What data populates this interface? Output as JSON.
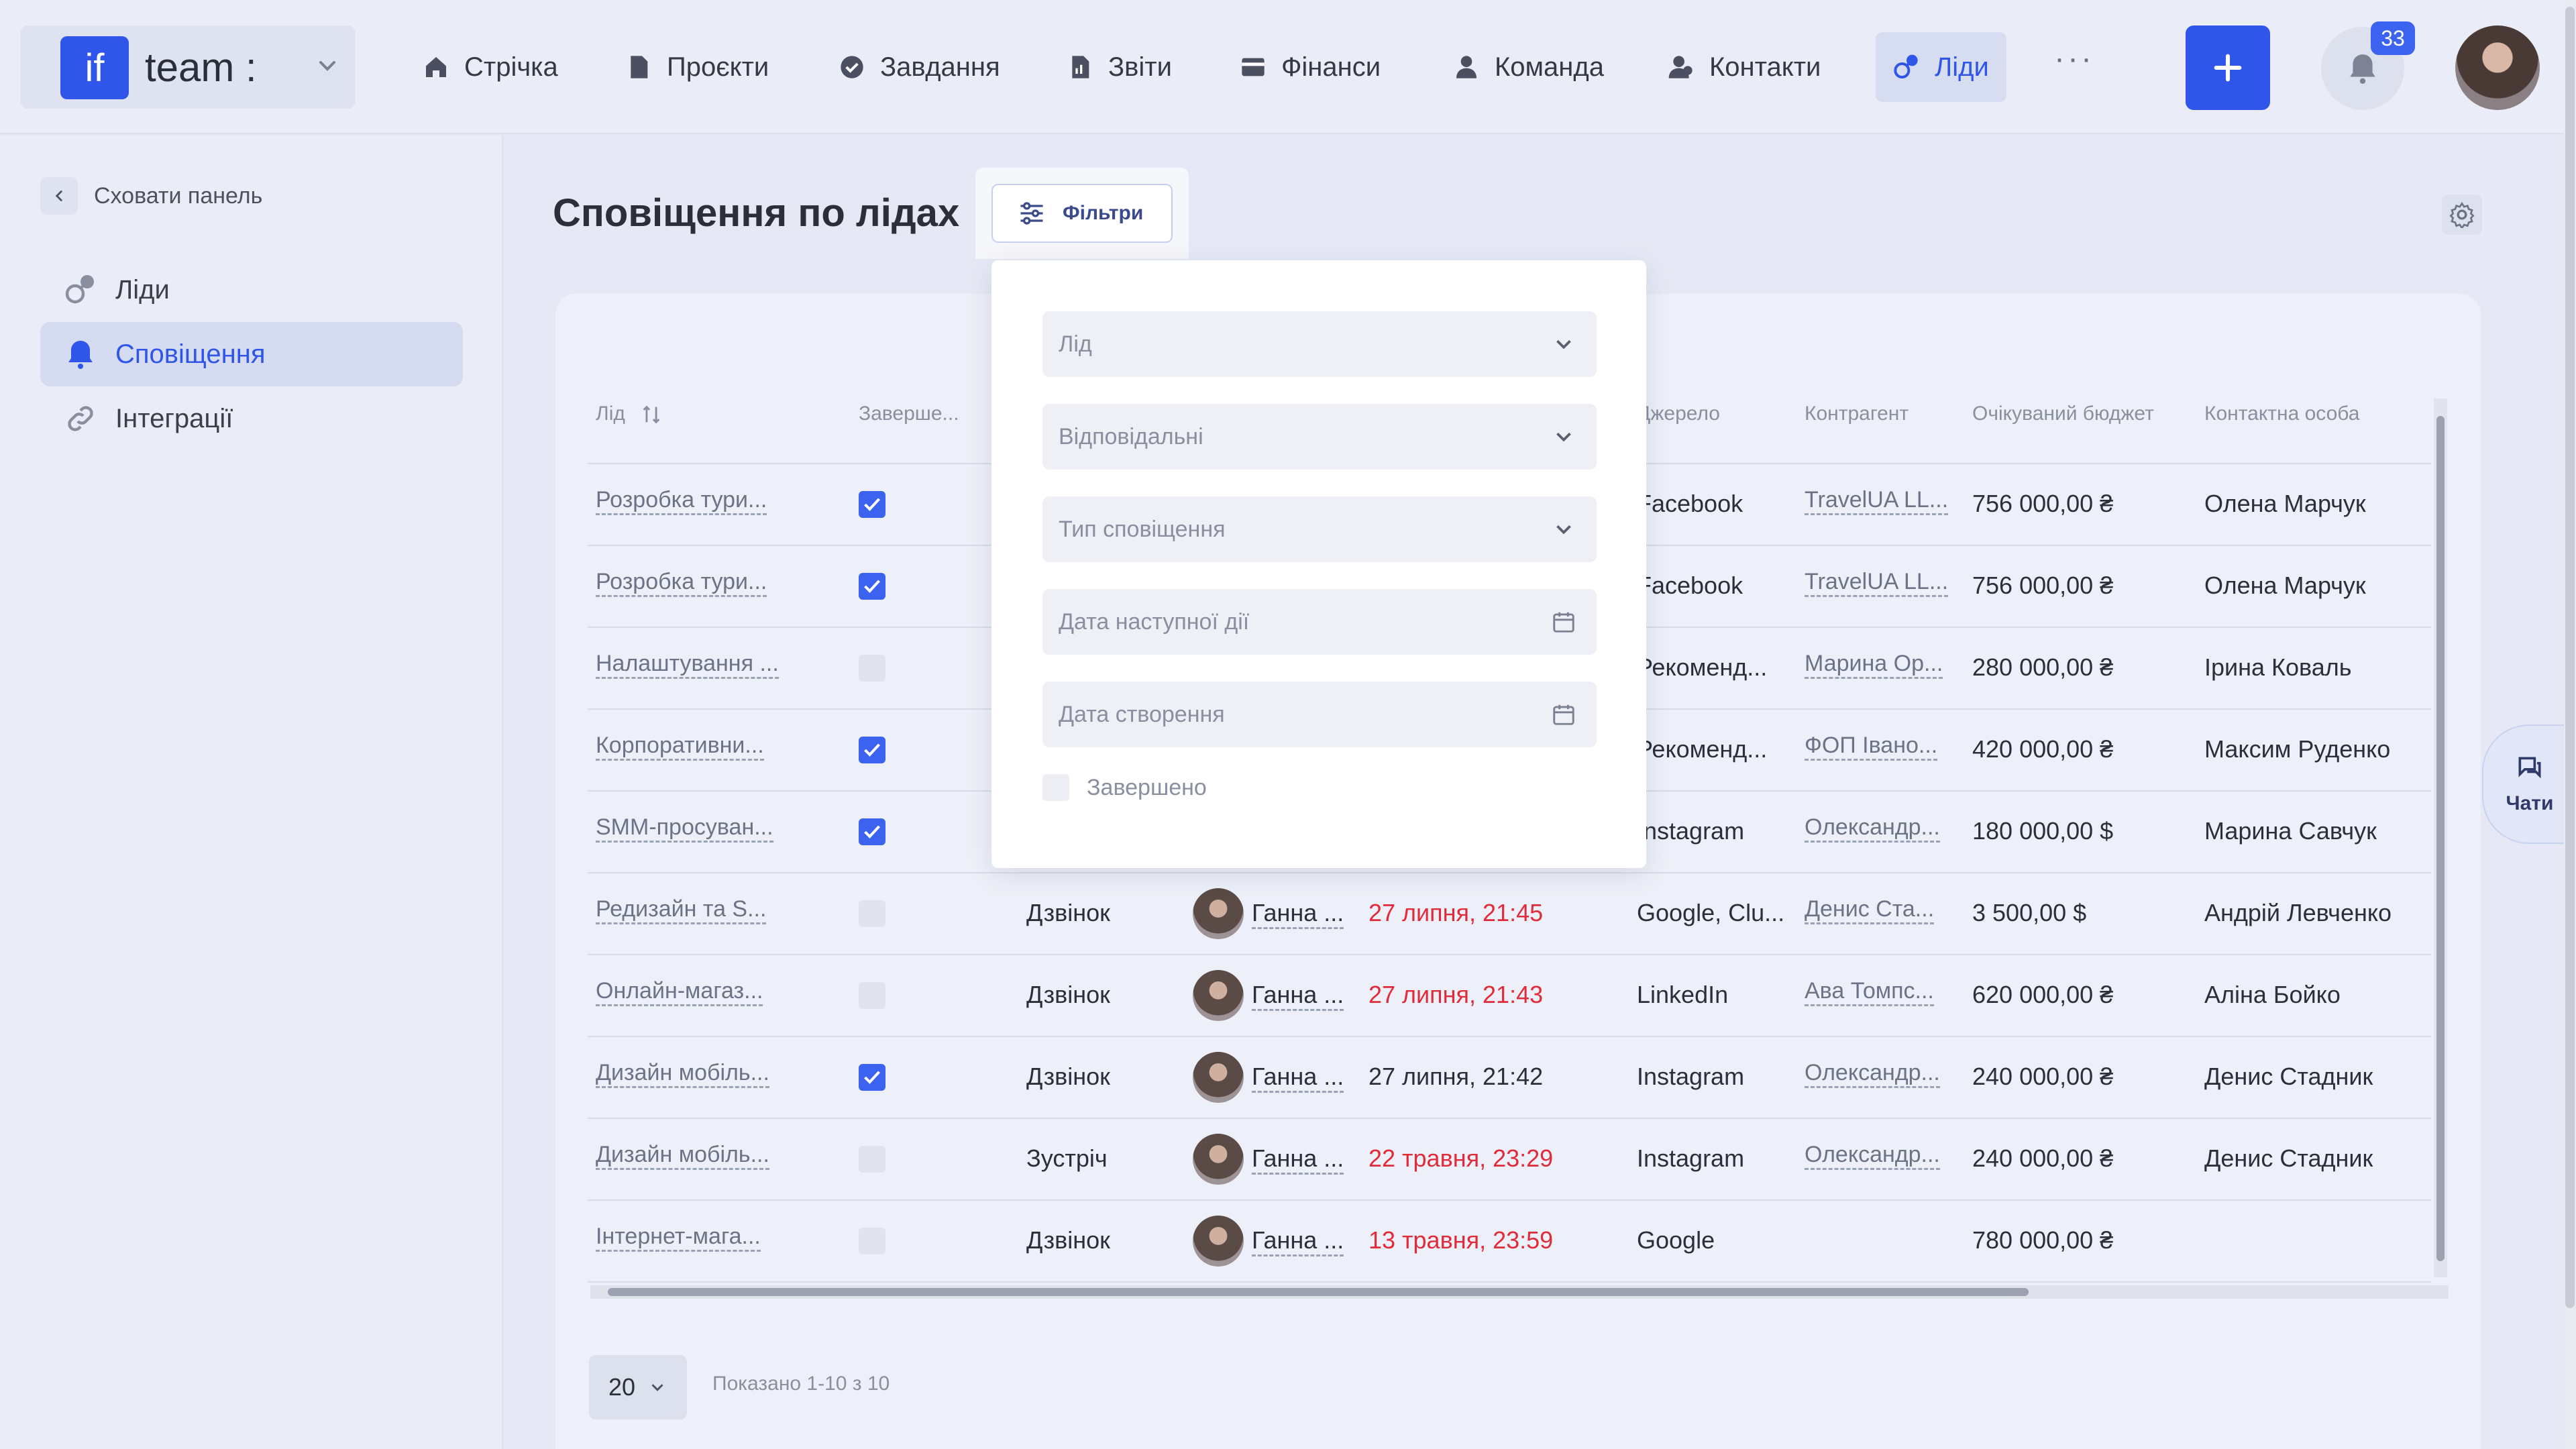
{
  "brand": {
    "logo": "if",
    "name": "team :"
  },
  "nav": [
    {
      "label": "Стрічка",
      "icon": "home-icon"
    },
    {
      "label": "Проєкти",
      "icon": "document-icon"
    },
    {
      "label": "Завдання",
      "icon": "check-circle-icon"
    },
    {
      "label": "Звіти",
      "icon": "report-icon"
    },
    {
      "label": "Фінанси",
      "icon": "wallet-icon"
    },
    {
      "label": "Команда",
      "icon": "person-icon"
    },
    {
      "label": "Контакти",
      "icon": "contacts-icon"
    },
    {
      "label": "Ліди",
      "icon": "leads-icon",
      "active": true
    }
  ],
  "nav_more": "···",
  "notifications_count": "33",
  "sidebar": {
    "hide_label": "Сховати панель",
    "items": [
      {
        "label": "Ліди",
        "icon": "leads-icon"
      },
      {
        "label": "Сповіщення",
        "icon": "bell-icon",
        "active": true
      },
      {
        "label": "Інтеграції",
        "icon": "link-icon"
      }
    ]
  },
  "page": {
    "title": "Сповіщення по лідах",
    "filters_button": "Фільтри"
  },
  "table": {
    "headers": {
      "lead": "Лід",
      "completed": "Заверше...",
      "source": "Джерело",
      "counterparty": "Контрагент",
      "budget": "Очікуваний бюджет",
      "contact": "Контактна особа"
    },
    "rows": [
      {
        "lead": "Розробка тури...",
        "done": true,
        "type": "",
        "resp": "",
        "date": "",
        "overdue": false,
        "source": "Facebook",
        "counterparty": "TravelUA LL...",
        "budget": "756 000,00 ₴",
        "contact": "Олена Марчук"
      },
      {
        "lead": "Розробка тури...",
        "done": true,
        "type": "",
        "resp": "",
        "date": "",
        "overdue": false,
        "source": "Facebook",
        "counterparty": "TravelUA LL...",
        "budget": "756 000,00 ₴",
        "contact": "Олена Марчук"
      },
      {
        "lead": "Налаштування ...",
        "done": false,
        "type": "",
        "resp": "",
        "date": "",
        "overdue": false,
        "source": "Рекоменд...",
        "counterparty": "Марина Ор...",
        "budget": "280 000,00 ₴",
        "contact": "Ірина Коваль"
      },
      {
        "lead": "Корпоративни...",
        "done": true,
        "type": "",
        "resp": "",
        "date": "",
        "overdue": false,
        "source": "Рекоменд...",
        "counterparty": "ФОП Івано...",
        "budget": "420 000,00 ₴",
        "contact": "Максим Руденко"
      },
      {
        "lead": "SMM-просуван...",
        "done": true,
        "type": "",
        "resp": "",
        "date": "",
        "overdue": false,
        "source": "Instagram",
        "counterparty": "Олександр...",
        "budget": "180 000,00 $",
        "contact": "Марина Савчук"
      },
      {
        "lead": "Редизайн та S...",
        "done": false,
        "type": "Дзвінок",
        "resp": "Ганна ...",
        "date": "27 липня, 21:45",
        "overdue": true,
        "source": "Google, Clu...",
        "counterparty": "Денис Ста...",
        "budget": "3 500,00 $",
        "contact": "Андрій Левченко"
      },
      {
        "lead": "Онлайн-магаз...",
        "done": false,
        "type": "Дзвінок",
        "resp": "Ганна ...",
        "date": "27 липня, 21:43",
        "overdue": true,
        "source": "LinkedIn",
        "counterparty": "Ава Томпс...",
        "budget": "620 000,00 ₴",
        "contact": "Аліна Бойко"
      },
      {
        "lead": "Дизайн мобіль...",
        "done": true,
        "type": "Дзвінок",
        "resp": "Ганна ...",
        "date": "27 липня, 21:42",
        "overdue": false,
        "source": "Instagram",
        "counterparty": "Олександр...",
        "budget": "240 000,00 ₴",
        "contact": "Денис Стадник"
      },
      {
        "lead": "Дизайн мобіль...",
        "done": false,
        "type": "Зустріч",
        "resp": "Ганна ...",
        "date": "22 травня, 23:29",
        "overdue": true,
        "source": "Instagram",
        "counterparty": "Олександр...",
        "budget": "240 000,00 ₴",
        "contact": "Денис Стадник"
      },
      {
        "lead": "Інтернет-мага...",
        "done": false,
        "type": "Дзвінок",
        "resp": "Ганна ...",
        "date": "13 травня, 23:59",
        "overdue": true,
        "source": "Google",
        "counterparty": "",
        "budget": "780 000,00 ₴",
        "contact": ""
      }
    ]
  },
  "pagination": {
    "per_page": "20",
    "shown": "Показано 1-10 з 10"
  },
  "chats_label": "Чати",
  "filters_popup": {
    "lead_placeholder": "Лід",
    "responsible_placeholder": "Відповідальні",
    "type_placeholder": "Тип сповіщення",
    "next_action_placeholder": "Дата наступної дії",
    "created_placeholder": "Дата створення",
    "completed_label": "Завершено"
  },
  "colors": {
    "accent": "#2f56e8",
    "overdue": "#e02b3a",
    "background": "#e6e9f5"
  }
}
